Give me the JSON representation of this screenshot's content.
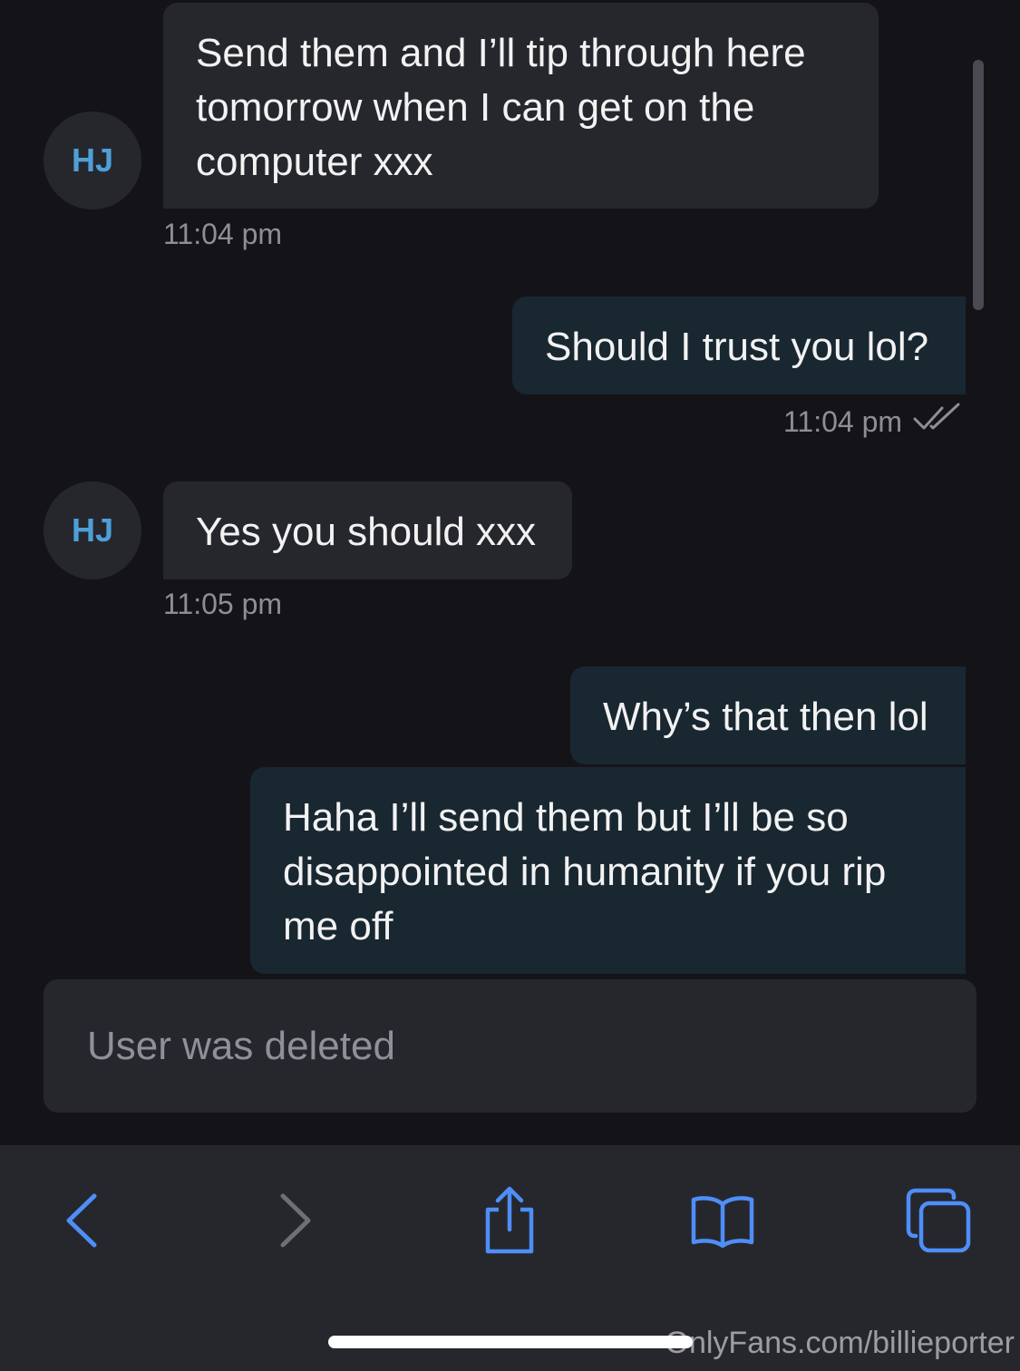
{
  "conversation": {
    "avatar_initials": "HJ",
    "messages": [
      {
        "from": "them",
        "text": "Send them and I’ll tip through here tomorrow when I can get on the computer xxx",
        "time": "11:04 pm"
      },
      {
        "from": "me",
        "text": "Should I trust you lol?",
        "time": "11:04 pm",
        "status": "read"
      },
      {
        "from": "them",
        "text": "Yes you should xxx",
        "time": "11:05 pm"
      },
      {
        "from": "me",
        "text": "Why’s that then lol"
      },
      {
        "from": "me",
        "text": "Haha I’ll send them but I’ll be so disappointed in humanity if you rip me off"
      }
    ]
  },
  "composer": {
    "status_text": "User was deleted"
  },
  "browser_toolbar": {
    "buttons": [
      {
        "name": "back",
        "icon": "chevron-left-icon",
        "enabled": true
      },
      {
        "name": "forward",
        "icon": "chevron-right-icon",
        "enabled": false
      },
      {
        "name": "share",
        "icon": "share-icon",
        "enabled": true
      },
      {
        "name": "bookmarks",
        "icon": "book-icon",
        "enabled": true
      },
      {
        "name": "tabs",
        "icon": "tabs-icon",
        "enabled": true
      }
    ],
    "accent_color": "#4e8ef7",
    "disabled_color": "#6f7076"
  },
  "watermark": "OnlyFans.com/billieporter"
}
